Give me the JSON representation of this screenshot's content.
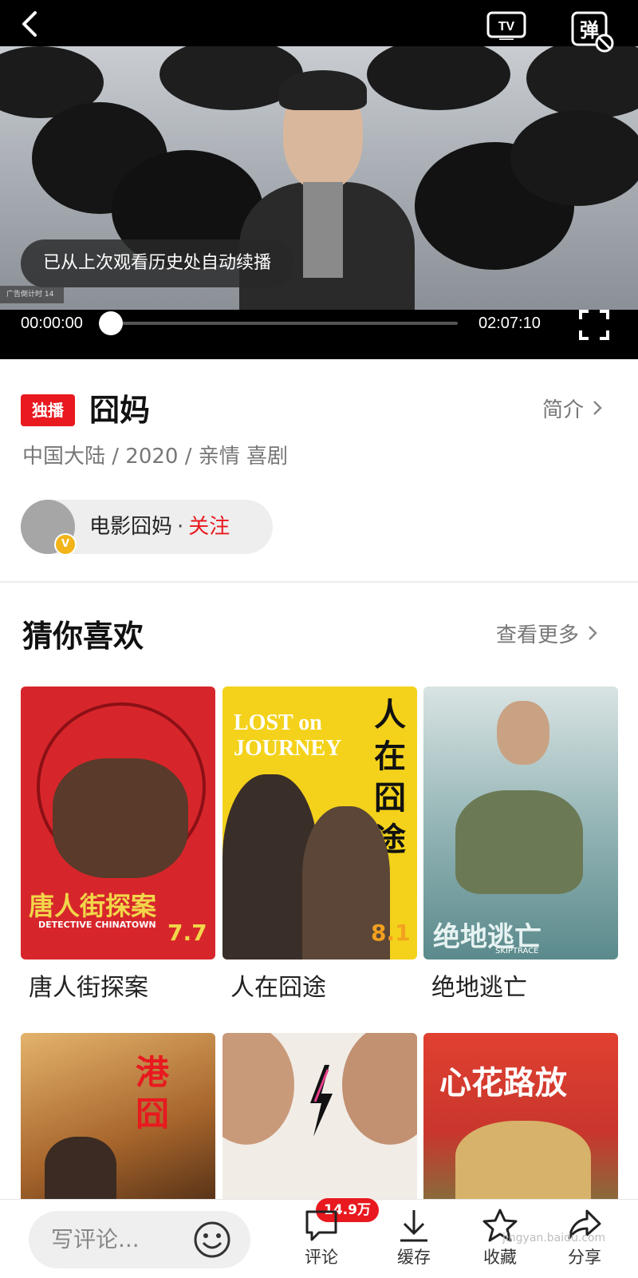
{
  "player": {
    "tv_label": "TV",
    "danmu_label": "弹",
    "resume_toast": "已从上次观看历史处自动续播",
    "ad_timer": "广告倒计时 14",
    "time_current": "00:00:00",
    "time_total": "02:07:10",
    "progress": 0
  },
  "info": {
    "badge": "独播",
    "title": "囧妈",
    "intro_label": "简介",
    "meta": "中国大陆 / 2020 / 亲情 喜剧",
    "follow": {
      "verified_mark": "V",
      "name": "电影囧妈",
      "dot": "·",
      "action": "关注"
    }
  },
  "recommend": {
    "title": "猜你喜欢",
    "see_more": "查看更多",
    "items": [
      {
        "title": "唐人街探案",
        "poster_text": "唐人街探案",
        "poster_subtext": "DETECTIVE CHINATOWN",
        "poster_date": "7.7",
        "bg": "#d7262b"
      },
      {
        "title": "人在囧途",
        "poster_text": "人在囧途",
        "poster_subtext": "LOST on JOURNEY",
        "poster_date": "8.1",
        "bg": "#f4d21b"
      },
      {
        "title": "绝地逃亡",
        "poster_text": "绝地逃亡",
        "poster_subtext": "SKIPTRACE",
        "poster_date": "",
        "bg": "#7fa7a9"
      },
      {
        "title": "",
        "poster_text": "港囧",
        "poster_subtext": "",
        "poster_date": "",
        "bg": "#b77a3a"
      },
      {
        "title": "",
        "poster_text": "",
        "poster_subtext": "",
        "poster_date": "",
        "bg": "#f1ece6"
      },
      {
        "title": "",
        "poster_text": "心花路放",
        "poster_subtext": "",
        "poster_date": "",
        "bg": "#c9362d"
      }
    ]
  },
  "bottom": {
    "comment_placeholder": "写评论...",
    "comment_count": "14.9万",
    "actions": [
      {
        "label": "评论",
        "icon": "comment-icon"
      },
      {
        "label": "缓存",
        "icon": "download-icon"
      },
      {
        "label": "收藏",
        "icon": "star-icon"
      },
      {
        "label": "分享",
        "icon": "share-icon"
      }
    ],
    "watermark": "jingyan.baidu.com"
  },
  "colors": {
    "accent": "#e8191f",
    "badge_gold": "#f2b418"
  }
}
